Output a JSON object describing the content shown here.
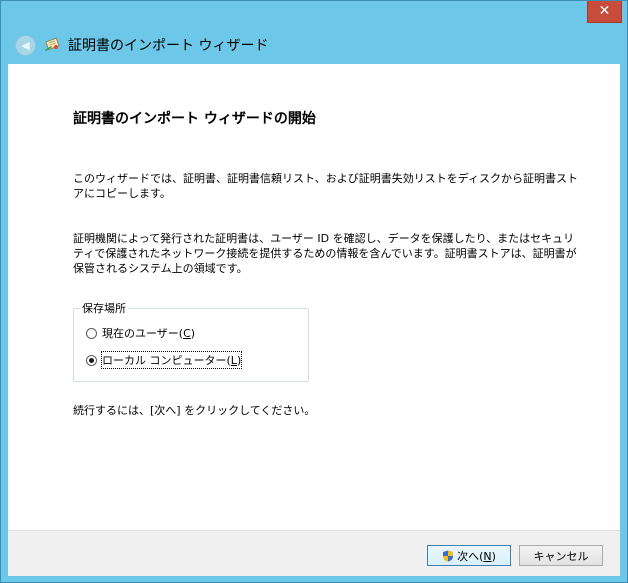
{
  "window": {
    "close_glyph": "✕"
  },
  "titlebar": {
    "title": "証明書のインポート ウィザード",
    "back_icon": "back-arrow-icon",
    "app_icon": "certificate-wizard-icon"
  },
  "content": {
    "heading": "証明書のインポート ウィザードの開始",
    "intro": "このウィザードでは、証明書、証明書信頼リスト、および証明書失効リストをディスクから証明書ストアにコピーします。",
    "description": "証明機関によって発行された証明書は、ユーザー ID を確認し、データを保護したり、またはセキュリティで保護されたネットワーク接続を提供するための情報を含んでいます。証明書ストアは、証明書が保管されるシステム上の領域です。",
    "store_location": {
      "label": "保存場所",
      "options": [
        {
          "text": "現在のユーザー(",
          "accel": "C",
          "close": ")",
          "checked": false
        },
        {
          "text": "ローカル コンピューター(",
          "accel": "L",
          "close": ")",
          "checked": true
        }
      ]
    },
    "continue_text": "続行するには、[次へ] をクリックしてください。"
  },
  "footer": {
    "next": {
      "text": "次へ(",
      "accel": "N",
      "close": ")"
    },
    "cancel": {
      "text": "キャンセル"
    }
  },
  "colors": {
    "frame": "#6cc7e8",
    "close": "#c74c3c",
    "content": "#ffffff",
    "footer": "#f0f0f0"
  }
}
